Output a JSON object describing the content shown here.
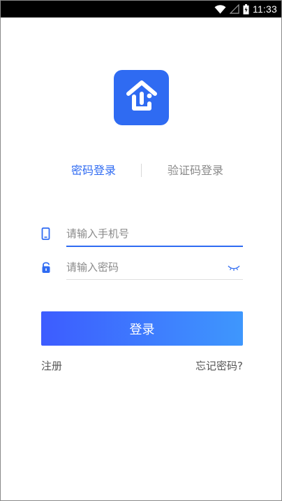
{
  "status_bar": {
    "time": "11:33",
    "icons": [
      "wifi-icon",
      "signal-icon",
      "battery-icon"
    ]
  },
  "logo": {
    "icon": "house-logo-icon",
    "color": "#2f6bf2"
  },
  "tabs": [
    {
      "label": "密码登录",
      "active": true
    },
    {
      "label": "验证码登录",
      "active": false
    }
  ],
  "form": {
    "phone": {
      "placeholder": "请输入手机号",
      "value": "",
      "icon": "phone-icon"
    },
    "password": {
      "placeholder": "请输入密码",
      "value": "",
      "icon": "lock-icon",
      "toggle_icon": "eye-closed-icon"
    }
  },
  "login_button": {
    "label": "登录"
  },
  "links": {
    "register": "注册",
    "forgot_password": "忘记密码?"
  },
  "colors": {
    "accent": "#2f6bf2",
    "button_gradient_start": "#3d5cff",
    "button_gradient_end": "#3e97fd"
  }
}
